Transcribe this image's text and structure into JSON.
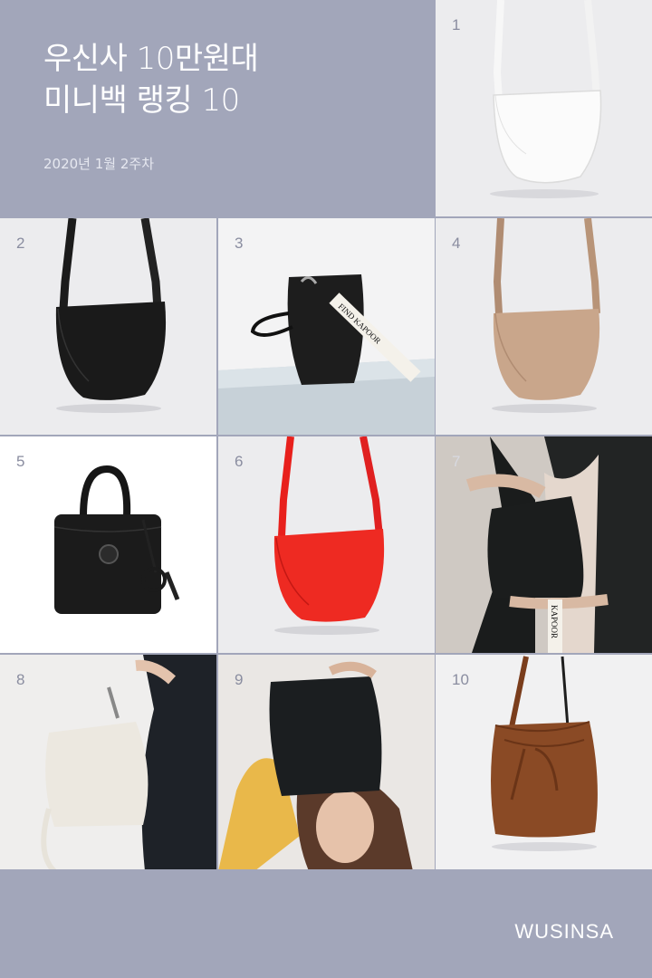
{
  "header": {
    "title_line1": "우신사 10만원대",
    "title_line2": "미니백 랭킹 10",
    "subtitle": "2020년 1월 2주차"
  },
  "items": [
    {
      "rank": "1",
      "bag": "white-saddle-bag"
    },
    {
      "rank": "2",
      "bag": "black-saddle-bag"
    },
    {
      "rank": "3",
      "bag": "black-bucket-bag",
      "strap_text": "FIND KAPOOR"
    },
    {
      "rank": "4",
      "bag": "beige-saddle-bag"
    },
    {
      "rank": "5",
      "bag": "black-top-handle-bag"
    },
    {
      "rank": "6",
      "bag": "red-saddle-bag"
    },
    {
      "rank": "7",
      "bag": "black-bucket-bag-model",
      "strap_text": "KAPOOR"
    },
    {
      "rank": "8",
      "bag": "white-bucket-bag-model"
    },
    {
      "rank": "9",
      "bag": "black-bucket-bag-on-head"
    },
    {
      "rank": "10",
      "bag": "brown-drawstring-bucket-bag"
    }
  ],
  "footer": {
    "brand": "WUSINSA"
  },
  "colors": {
    "background": "#a2a6ba",
    "tile": "#ebebed",
    "accent_red": "#e8201c"
  }
}
